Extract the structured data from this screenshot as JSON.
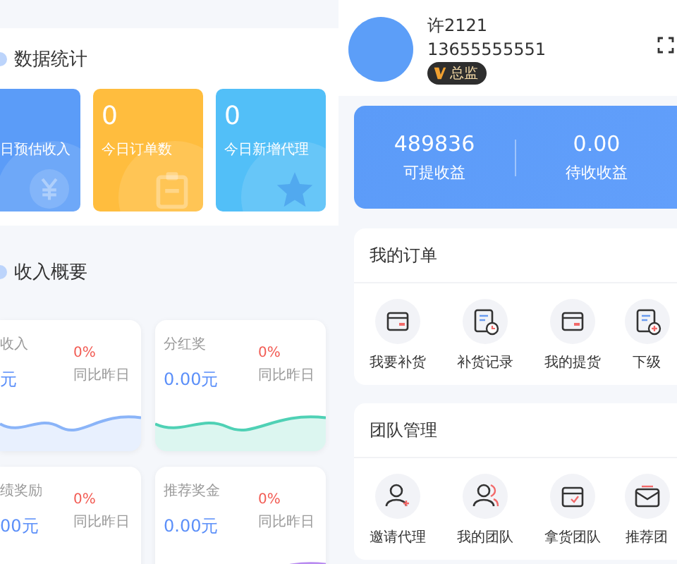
{
  "stats": {
    "title": "数据统计",
    "cards": [
      {
        "label": "日预估收入",
        "color": "#5b9cf8",
        "kind": "yuan"
      },
      {
        "value": "0",
        "label": "今日订单数",
        "color": "#ffbd3e",
        "kind": "clipboard"
      },
      {
        "value": "0",
        "label": "今日新增代理",
        "color": "#52bff8",
        "kind": "star"
      }
    ]
  },
  "income": {
    "title": "收入概要",
    "cards": [
      {
        "label": "收入",
        "value": "元",
        "change": "0%",
        "compare": "同比昨日",
        "color": "#8ab4f8"
      },
      {
        "label": "分红奖",
        "value": "0.00元",
        "change": "0%",
        "compare": "同比昨日",
        "color": "#4fd1b5"
      },
      {
        "label": "绩奖励",
        "value": "00元",
        "change": "0%",
        "compare": "同比昨日"
      },
      {
        "label": "推荐奖金",
        "value": "0.00元",
        "change": "0%",
        "compare": "同比昨日",
        "color": "#b98cf0"
      }
    ]
  },
  "profile": {
    "name": "许2121",
    "phone": "13655555551",
    "badge": "总监"
  },
  "earnings": [
    {
      "value": "489836",
      "label": "可提收益"
    },
    {
      "value": "0.00",
      "label": "待收收益"
    }
  ],
  "orders": {
    "title": "我的订单",
    "items": [
      {
        "label": "我要补货",
        "kind": "window"
      },
      {
        "label": "补货记录",
        "kind": "record"
      },
      {
        "label": "我的提货",
        "kind": "window"
      },
      {
        "label": "下级",
        "kind": "record-plus"
      }
    ]
  },
  "team": {
    "title": "团队管理",
    "items": [
      {
        "label": "邀请代理",
        "kind": "user-plus"
      },
      {
        "label": "我的团队",
        "kind": "users"
      },
      {
        "label": "拿货团队",
        "kind": "box"
      },
      {
        "label": "推荐团",
        "kind": "mail"
      }
    ]
  }
}
